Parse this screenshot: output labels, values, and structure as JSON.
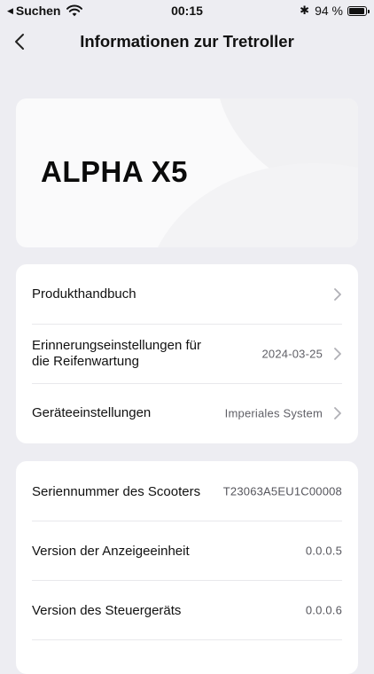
{
  "status_bar": {
    "carrier": "Suchen",
    "time": "00:15",
    "battery_percent": "94 %",
    "battery_level": 0.94
  },
  "nav": {
    "title": "Informationen zur Tretroller"
  },
  "hero": {
    "model": "ALPHA X5"
  },
  "settings": {
    "items": [
      {
        "label": "Produkthandbuch",
        "value": ""
      },
      {
        "label": "Erinnerungseinstellungen für die Reifenwartung",
        "value": "2024-03-25"
      },
      {
        "label": "Geräteeinstellungen",
        "value": "Imperiales System"
      }
    ]
  },
  "info": {
    "items": [
      {
        "label": "Seriennummer des Scooters",
        "value": "T23063A5EU1C00008"
      },
      {
        "label": "Version der Anzeigeeinheit",
        "value": "0.0.0.5"
      },
      {
        "label": "Version des Steuergeräts",
        "value": "0.0.0.6"
      }
    ]
  },
  "colors": {
    "background": "#ededf2",
    "card": "#ffffff",
    "secondary_text": "#5f5f66"
  }
}
